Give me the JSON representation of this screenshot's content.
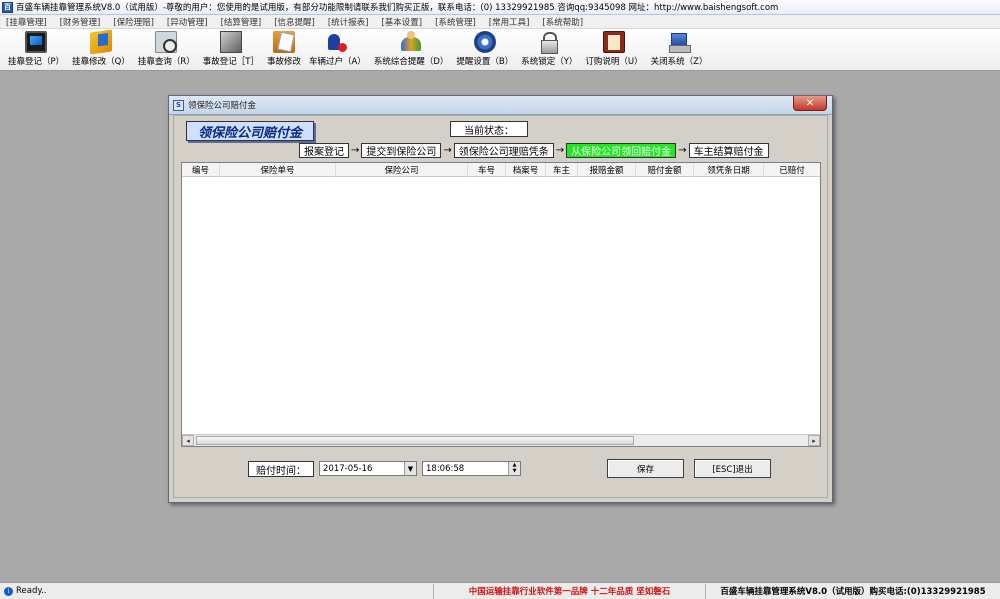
{
  "app": {
    "title": "百盛车辆挂靠管理系统V8.0（试用版）-尊敬的用户：您使用的是试用版，有部分功能限制请联系我们购买正版，联系电话：(0) 13329921985  咨询qq:9345098  网址：http://www.baishengsoft.com"
  },
  "menu": [
    "[挂靠管理]",
    "[财务管理]",
    "[保险理赔]",
    "[异动管理]",
    "[结算管理]",
    "[信息提醒]",
    "[统计报表]",
    "[基本设置]",
    "[系统管理]",
    "[常用工具]",
    "[系统帮助]"
  ],
  "toolbar": [
    {
      "label": "挂靠登记（P）",
      "icon": "monitor-icon"
    },
    {
      "label": "挂靠修改（Q）",
      "icon": "book-icon"
    },
    {
      "label": "挂靠查询（R）",
      "icon": "search-icon"
    },
    {
      "label": "事故登记［T］",
      "icon": "cube-icon"
    },
    {
      "label": "事故修改",
      "icon": "folder-icon"
    },
    {
      "label": "车辆过户（A）",
      "icon": "people-icon"
    },
    {
      "label": "系统综合提醒（D）",
      "icon": "users-icon"
    },
    {
      "label": "提醒设置（B）",
      "icon": "gear-icon"
    },
    {
      "label": "系统锁定（Y）",
      "icon": "lock-icon"
    },
    {
      "label": "订购说明（U）",
      "icon": "manual-icon"
    },
    {
      "label": "关闭系统（Z）",
      "icon": "exit-icon"
    }
  ],
  "dialog": {
    "title": "领保险公司赔付金",
    "close_label": "✕",
    "big_title": "领保险公司赔付金",
    "status_label": "当前状态：",
    "steps": [
      {
        "label": "报案登记",
        "active": false
      },
      {
        "label": "提交到保险公司",
        "active": false
      },
      {
        "label": "领保险公司理赔凭条",
        "active": false
      },
      {
        "label": "从保险公司领回赔付金",
        "active": true
      },
      {
        "label": "车主结算赔付金",
        "active": false
      }
    ],
    "step_arrow": "→",
    "columns": [
      "编号",
      "保险单号",
      "保险公司",
      "车号",
      "档案号",
      "车主",
      "报赔金额",
      "赔付金额",
      "领凭条日期",
      "已赔付"
    ],
    "rows": [],
    "time_label": "赔付时间：",
    "date_value": "2017-05-16",
    "time_value": "18:06:58",
    "save_label": "保存",
    "exit_label": "[ESC]退出"
  },
  "statusbar": {
    "ready": "Ready..",
    "slogan": "中国运输挂靠行业软件第一品牌    十二年品质 坚如磐石",
    "product": "百盛车辆挂靠管理系统V8.0（试用版）购买电话:(0)13329921985"
  },
  "colors": {
    "active_step": "#22e622",
    "slogan_red": "#d01010",
    "desktop": "#a9a9a9"
  }
}
